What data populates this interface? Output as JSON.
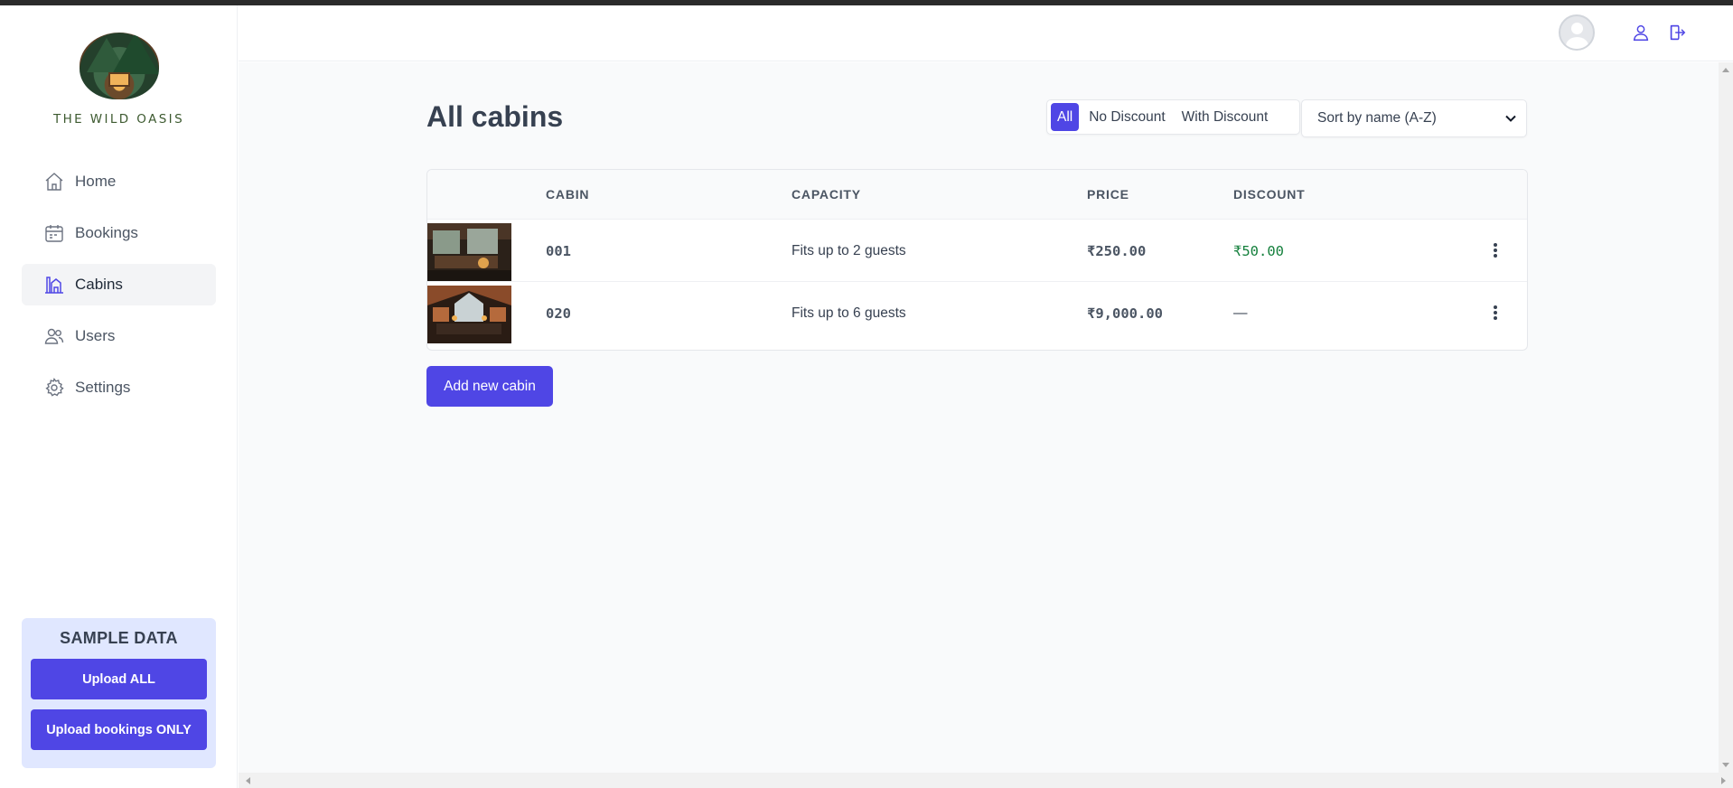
{
  "app": {
    "logo_text": "THE WILD OASIS"
  },
  "sidebar": {
    "items": [
      {
        "label": "Home",
        "icon": "home-icon"
      },
      {
        "label": "Bookings",
        "icon": "calendar-icon"
      },
      {
        "label": "Cabins",
        "icon": "cabins-icon",
        "active": true
      },
      {
        "label": "Users",
        "icon": "users-icon"
      },
      {
        "label": "Settings",
        "icon": "gear-icon"
      }
    ],
    "sample": {
      "title": "SAMPLE DATA",
      "upload_all": "Upload ALL",
      "upload_bookings": "Upload bookings ONLY"
    }
  },
  "header": {
    "icons": [
      "avatar",
      "user-icon",
      "logout-icon"
    ]
  },
  "main": {
    "title": "All cabins",
    "filters": [
      "All",
      "No Discount",
      "With Discount"
    ],
    "active_filter": "All",
    "sort": {
      "selected": "Sort by name (A-Z)"
    },
    "table": {
      "headers": [
        "",
        "CABIN",
        "CAPACITY",
        "PRICE",
        "DISCOUNT",
        ""
      ],
      "rows": [
        {
          "cabin": "001",
          "capacity": "Fits up to 2 guests",
          "price": "₹250.00",
          "discount": "₹50.00"
        },
        {
          "cabin": "020",
          "capacity": "Fits up to 6 guests",
          "price": "₹9,000.00",
          "discount": "—"
        }
      ]
    },
    "add_button": "Add new cabin"
  },
  "colors": {
    "accent": "#4f46e5",
    "discount_green": "#15803d",
    "sidebar_active_bg": "#f3f4f6",
    "sample_bg": "#e0e7ff"
  }
}
